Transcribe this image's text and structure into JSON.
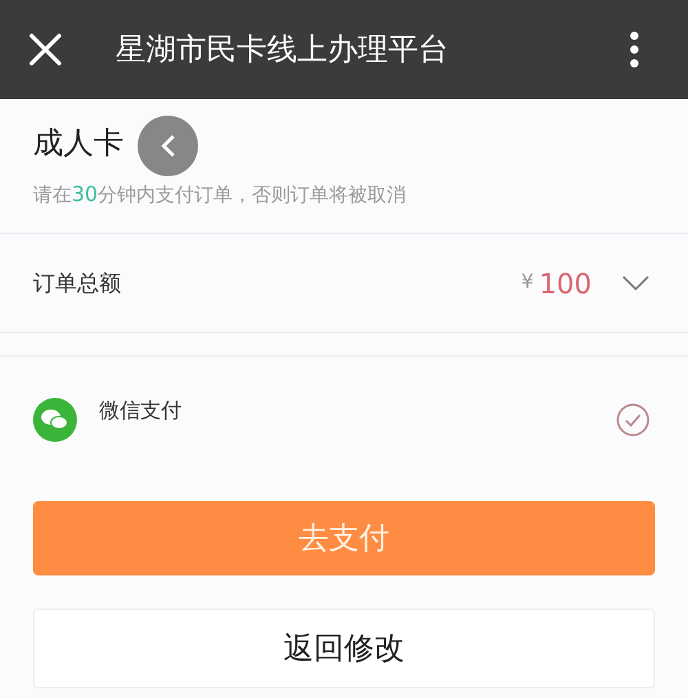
{
  "header": {
    "title": "星湖市民卡线上办理平台"
  },
  "card": {
    "title": "成人卡",
    "notice": [
      {
        "text": "请在",
        "highlight": false
      },
      {
        "text": "30",
        "highlight": true
      },
      {
        "text": "分钟内支付订单，否则订单将被取消",
        "highlight": false
      }
    ]
  },
  "order": {
    "label": "订单总额",
    "currency": "¥",
    "amount": "100",
    "expanded": false
  },
  "payment_methods": [
    {
      "label": "微信支付",
      "selected": true
    }
  ],
  "buttons": [
    {
      "label": "去支付",
      "kind": "primary"
    },
    {
      "label": "返回修改",
      "kind": "secondary"
    }
  ]
}
